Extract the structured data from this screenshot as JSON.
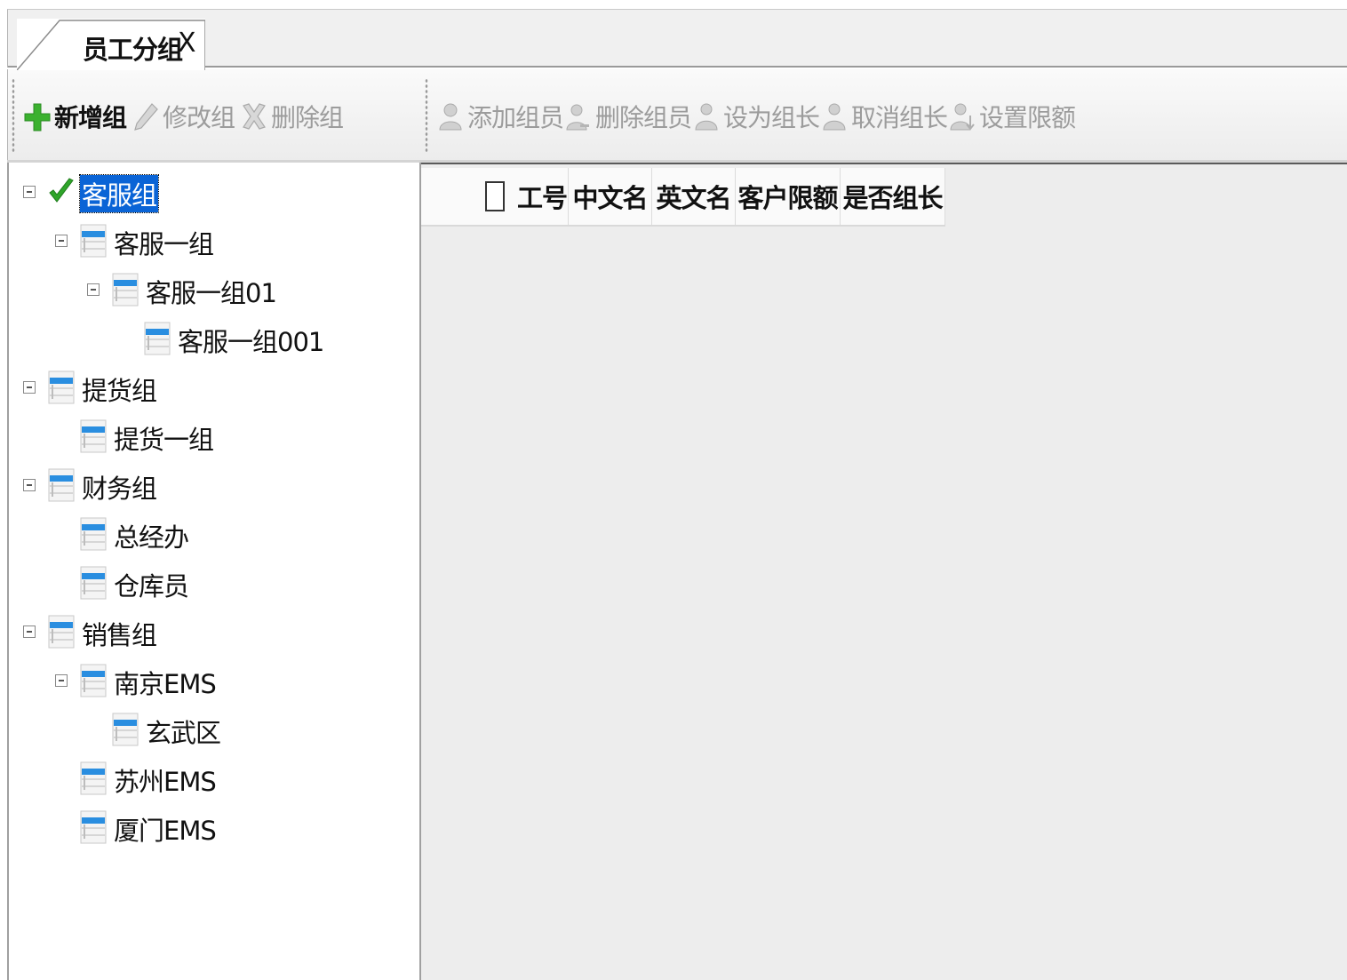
{
  "tab": {
    "title": "员工分组",
    "close": "X"
  },
  "toolbar_left": [
    {
      "label": "新增组",
      "icon": "plus-icon",
      "enabled": true
    },
    {
      "label": "修改组",
      "icon": "pencil-icon",
      "enabled": false
    },
    {
      "label": "删除组",
      "icon": "delete-x-icon",
      "enabled": false
    }
  ],
  "toolbar_right": [
    {
      "label": "添加组员",
      "icon": "add-user-icon",
      "enabled": false
    },
    {
      "label": "删除组员",
      "icon": "remove-user-icon",
      "enabled": false
    },
    {
      "label": "设为组长",
      "icon": "leader-user-icon",
      "enabled": false
    },
    {
      "label": "取消组长",
      "icon": "cancel-leader-icon",
      "enabled": false
    },
    {
      "label": "设置限额",
      "icon": "limit-user-icon",
      "enabled": false
    }
  ],
  "tree": [
    {
      "label": "客服组",
      "level": 0,
      "expanded": true,
      "selected": true,
      "checked": true
    },
    {
      "label": "客服一组",
      "level": 1,
      "expanded": true
    },
    {
      "label": "客服一组01",
      "level": 2,
      "expanded": true
    },
    {
      "label": "客服一组001",
      "level": 3
    },
    {
      "label": "提货组",
      "level": 0,
      "expanded": true
    },
    {
      "label": "提货一组",
      "level": 1
    },
    {
      "label": "财务组",
      "level": 0,
      "expanded": true
    },
    {
      "label": "总经办",
      "level": 1
    },
    {
      "label": "仓库员",
      "level": 1
    },
    {
      "label": "销售组",
      "level": 0,
      "expanded": true
    },
    {
      "label": "南京EMS",
      "level": 1,
      "expanded": true
    },
    {
      "label": "玄武区",
      "level": 2
    },
    {
      "label": "苏州EMS",
      "level": 1
    },
    {
      "label": "厦门EMS",
      "level": 1
    }
  ],
  "grid": {
    "columns": [
      "工号",
      "中文名",
      "英文名",
      "客户限额",
      "是否组长"
    ],
    "rows": []
  },
  "colors": {
    "selection": "#0a64d6",
    "plus_green": "#3bb12f",
    "icon_blue": "#2a8ee0"
  }
}
